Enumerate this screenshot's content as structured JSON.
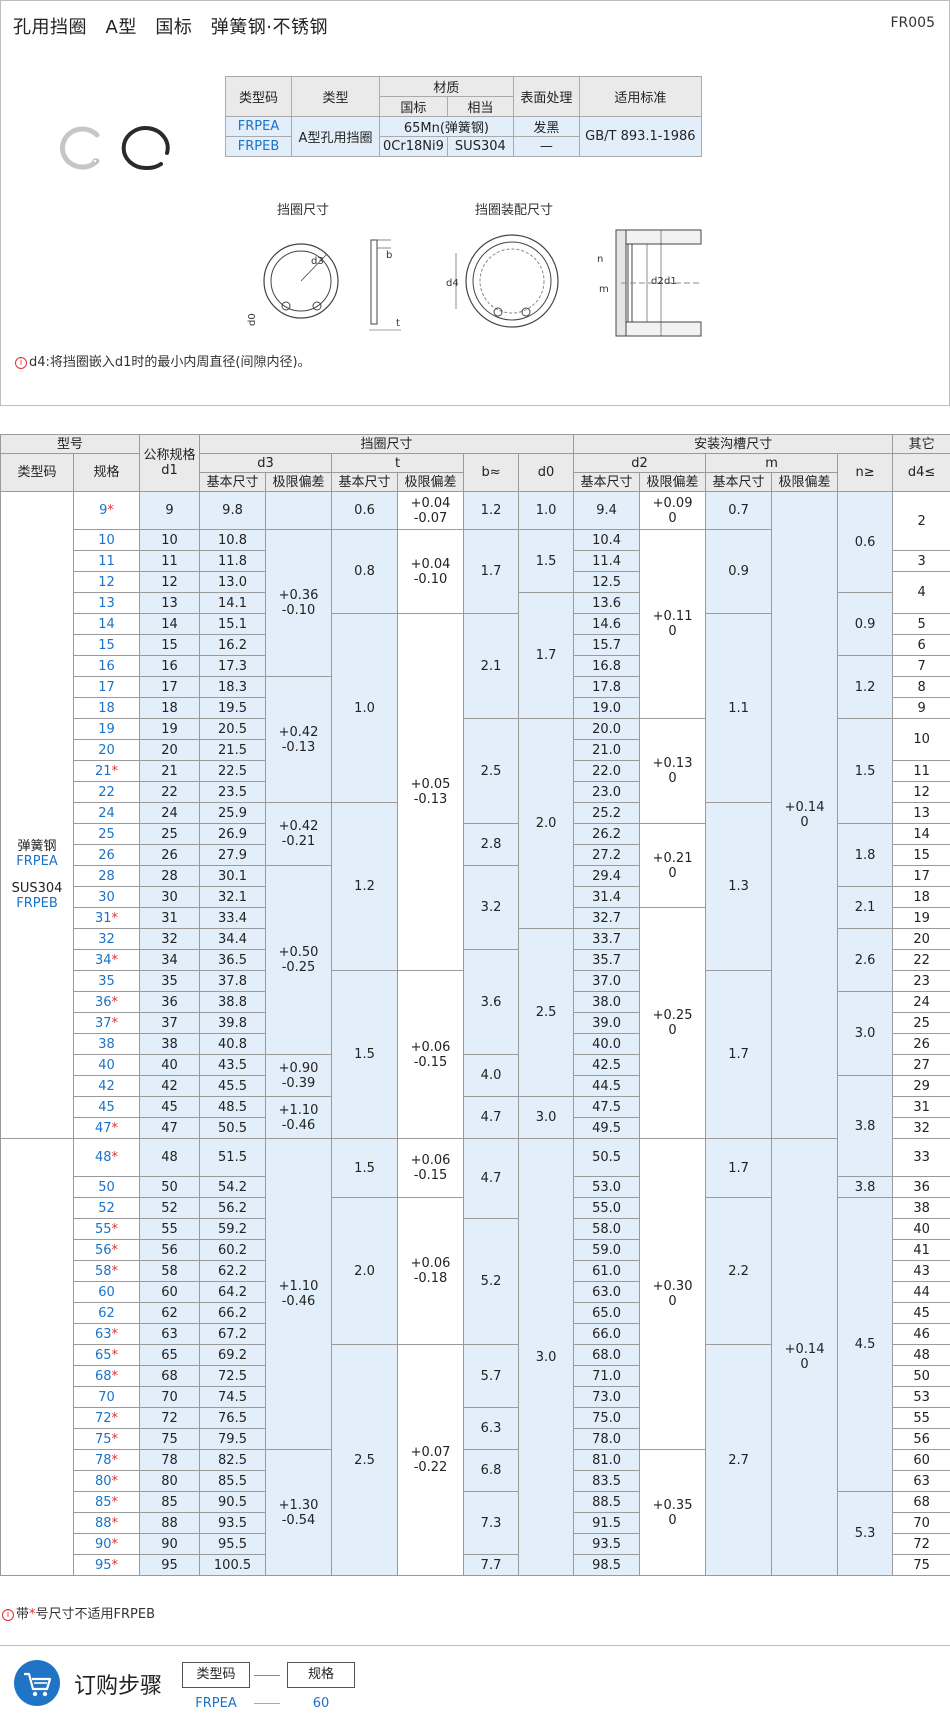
{
  "header": {
    "title": "孔用挡圈　A型　国标　弹簧钢·不锈钢",
    "code": "FR005"
  },
  "material_table": {
    "h_type_code": "类型码",
    "h_type": "类型",
    "h_material": "材质",
    "h_gb": "国标",
    "h_equiv": "相当",
    "h_surface": "表面处理",
    "h_standard": "适用标准",
    "type": "A型孔用挡圈",
    "standard": "GB/T 893.1-1986",
    "rows": [
      {
        "code": "FRPEA",
        "gb": "65Mn(弹簧钢)",
        "equiv": "",
        "surface": "发黑"
      },
      {
        "code": "FRPEB",
        "gb": "0Cr18Ni9",
        "equiv": "SUS304",
        "surface": "—"
      }
    ]
  },
  "diagram": {
    "cap_ring": "挡圈尺寸",
    "cap_assembly": "挡圈装配尺寸",
    "labels": {
      "d3": "d3",
      "d0": "d0",
      "b": "b",
      "t": "t",
      "d4": "d4",
      "n": "n",
      "m": "m",
      "d2": "d2",
      "d1": "d1"
    }
  },
  "note": {
    "icon": "i",
    "text": "d4:将挡圈嵌入d1时的最小内周直径(间隙内径)。"
  },
  "spec_table": {
    "h_model": "型号",
    "h_nominal": "公称规格d1",
    "h_ring": "挡圈尺寸",
    "h_groove": "安装沟槽尺寸",
    "h_other": "其它",
    "h_type_code": "类型码",
    "h_spec": "规格",
    "h_d3": "d3",
    "h_t": "t",
    "h_b": "b≈",
    "h_d0": "d0",
    "h_d2": "d2",
    "h_m": "m",
    "h_n": "n≥",
    "h_d4": "d4≤",
    "h_basic": "基本尺寸",
    "h_tol": "极限偏差",
    "type_label": {
      "mat1": "弹簧钢",
      "code1": "FRPEA",
      "mat2": "SUS304",
      "code2": "FRPEB"
    },
    "rows": [
      {
        "spec": "9",
        "star": true,
        "d1": "9",
        "d3": "9.8",
        "d2": "9.4"
      },
      {
        "spec": "10",
        "star": false,
        "d1": "10",
        "d3": "10.8",
        "d2": "10.4"
      },
      {
        "spec": "11",
        "star": false,
        "d1": "11",
        "d3": "11.8",
        "d2": "11.4"
      },
      {
        "spec": "12",
        "star": false,
        "d1": "12",
        "d3": "13.0",
        "d2": "12.5"
      },
      {
        "spec": "13",
        "star": false,
        "d1": "13",
        "d3": "14.1",
        "d2": "13.6"
      },
      {
        "spec": "14",
        "star": false,
        "d1": "14",
        "d3": "15.1",
        "d2": "14.6"
      },
      {
        "spec": "15",
        "star": false,
        "d1": "15",
        "d3": "16.2",
        "d2": "15.7"
      },
      {
        "spec": "16",
        "star": false,
        "d1": "16",
        "d3": "17.3",
        "d2": "16.8"
      },
      {
        "spec": "17",
        "star": false,
        "d1": "17",
        "d3": "18.3",
        "d2": "17.8"
      },
      {
        "spec": "18",
        "star": false,
        "d1": "18",
        "d3": "19.5",
        "d2": "19.0"
      },
      {
        "spec": "19",
        "star": false,
        "d1": "19",
        "d3": "20.5",
        "d2": "20.0"
      },
      {
        "spec": "20",
        "star": false,
        "d1": "20",
        "d3": "21.5",
        "d2": "21.0"
      },
      {
        "spec": "21",
        "star": true,
        "d1": "21",
        "d3": "22.5",
        "d2": "22.0"
      },
      {
        "spec": "22",
        "star": false,
        "d1": "22",
        "d3": "23.5",
        "d2": "23.0"
      },
      {
        "spec": "24",
        "star": false,
        "d1": "24",
        "d3": "25.9",
        "d2": "25.2"
      },
      {
        "spec": "25",
        "star": false,
        "d1": "25",
        "d3": "26.9",
        "d2": "26.2"
      },
      {
        "spec": "26",
        "star": false,
        "d1": "26",
        "d3": "27.9",
        "d2": "27.2"
      },
      {
        "spec": "28",
        "star": false,
        "d1": "28",
        "d3": "30.1",
        "d2": "29.4"
      },
      {
        "spec": "30",
        "star": false,
        "d1": "30",
        "d3": "32.1",
        "d2": "31.4"
      },
      {
        "spec": "31",
        "star": true,
        "d1": "31",
        "d3": "33.4",
        "d2": "32.7"
      },
      {
        "spec": "32",
        "star": false,
        "d1": "32",
        "d3": "34.4",
        "d2": "33.7"
      },
      {
        "spec": "34",
        "star": true,
        "d1": "34",
        "d3": "36.5",
        "d2": "35.7"
      },
      {
        "spec": "35",
        "star": false,
        "d1": "35",
        "d3": "37.8",
        "d2": "37.0"
      },
      {
        "spec": "36",
        "star": true,
        "d1": "36",
        "d3": "38.8",
        "d2": "38.0"
      },
      {
        "spec": "37",
        "star": true,
        "d1": "37",
        "d3": "39.8",
        "d2": "39.0"
      },
      {
        "spec": "38",
        "star": false,
        "d1": "38",
        "d3": "40.8",
        "d2": "40.0"
      },
      {
        "spec": "40",
        "star": false,
        "d1": "40",
        "d3": "43.5",
        "d2": "42.5"
      },
      {
        "spec": "42",
        "star": false,
        "d1": "42",
        "d3": "45.5",
        "d2": "44.5"
      },
      {
        "spec": "45",
        "star": false,
        "d1": "45",
        "d3": "48.5",
        "d2": "47.5"
      },
      {
        "spec": "47",
        "star": true,
        "d1": "47",
        "d3": "50.5",
        "d2": "49.5"
      },
      {
        "spec": "48",
        "star": true,
        "d1": "48",
        "d3": "51.5",
        "d2": "50.5"
      },
      {
        "spec": "50",
        "star": false,
        "d1": "50",
        "d3": "54.2",
        "d2": "53.0"
      },
      {
        "spec": "52",
        "star": false,
        "d1": "52",
        "d3": "56.2",
        "d2": "55.0"
      },
      {
        "spec": "55",
        "star": true,
        "d1": "55",
        "d3": "59.2",
        "d2": "58.0"
      },
      {
        "spec": "56",
        "star": true,
        "d1": "56",
        "d3": "60.2",
        "d2": "59.0"
      },
      {
        "spec": "58",
        "star": true,
        "d1": "58",
        "d3": "62.2",
        "d2": "61.0"
      },
      {
        "spec": "60",
        "star": false,
        "d1": "60",
        "d3": "64.2",
        "d2": "63.0"
      },
      {
        "spec": "62",
        "star": false,
        "d1": "62",
        "d3": "66.2",
        "d2": "65.0"
      },
      {
        "spec": "63",
        "star": true,
        "d1": "63",
        "d3": "67.2",
        "d2": "66.0"
      },
      {
        "spec": "65",
        "star": true,
        "d1": "65",
        "d3": "69.2",
        "d2": "68.0"
      },
      {
        "spec": "68",
        "star": true,
        "d1": "68",
        "d3": "72.5",
        "d2": "71.0"
      },
      {
        "spec": "70",
        "star": false,
        "d1": "70",
        "d3": "74.5",
        "d2": "73.0"
      },
      {
        "spec": "72",
        "star": true,
        "d1": "72",
        "d3": "76.5",
        "d2": "75.0"
      },
      {
        "spec": "75",
        "star": true,
        "d1": "75",
        "d3": "79.5",
        "d2": "78.0"
      },
      {
        "spec": "78",
        "star": true,
        "d1": "78",
        "d3": "82.5",
        "d2": "81.0"
      },
      {
        "spec": "80",
        "star": true,
        "d1": "80",
        "d3": "85.5",
        "d2": "83.5"
      },
      {
        "spec": "85",
        "star": true,
        "d1": "85",
        "d3": "90.5",
        "d2": "88.5"
      },
      {
        "spec": "88",
        "star": true,
        "d1": "88",
        "d3": "93.5",
        "d2": "91.5"
      },
      {
        "spec": "90",
        "star": true,
        "d1": "90",
        "d3": "95.5",
        "d2": "93.5"
      },
      {
        "spec": "95",
        "star": true,
        "d1": "95",
        "d3": "100.5",
        "d2": "98.5"
      }
    ],
    "spans": {
      "d3tol": [
        [
          0,
          1,
          "",
          "b"
        ],
        [
          1,
          7,
          "+0.36\n-0.10",
          "b"
        ],
        [
          8,
          6,
          "+0.42\n-0.13",
          "b"
        ],
        [
          14,
          3,
          "+0.42\n-0.21",
          "b"
        ],
        [
          17,
          9,
          "+0.50\n-0.25",
          "b"
        ],
        [
          26,
          2,
          "+0.90\n-0.39",
          "b"
        ],
        [
          28,
          2,
          "+1.10\n-0.46",
          "b"
        ],
        [
          30,
          14,
          "+1.10\n-0.46",
          "b"
        ],
        [
          44,
          6,
          "+1.30\n-0.54",
          "b"
        ]
      ],
      "t": [
        [
          0,
          1,
          "0.6",
          "b"
        ],
        [
          1,
          4,
          "0.8",
          "b"
        ],
        [
          5,
          9,
          "1.0",
          "b"
        ],
        [
          14,
          8,
          "1.2",
          "b"
        ],
        [
          22,
          8,
          "1.5",
          "b"
        ],
        [
          30,
          2,
          "1.5",
          "b"
        ],
        [
          32,
          7,
          "2.0",
          "b"
        ],
        [
          39,
          11,
          "2.5",
          "b"
        ]
      ],
      "ttol": [
        [
          0,
          1,
          "+0.04\n-0.07",
          "w"
        ],
        [
          1,
          4,
          "+0.04\n-0.10",
          "w"
        ],
        [
          5,
          17,
          "+0.05\n-0.13",
          "w"
        ],
        [
          22,
          8,
          "+0.06\n-0.15",
          "w"
        ],
        [
          30,
          2,
          "+0.06\n-0.15",
          "w"
        ],
        [
          32,
          7,
          "+0.06\n-0.18",
          "w"
        ],
        [
          39,
          11,
          "+0.07\n-0.22",
          "w"
        ]
      ],
      "b": [
        [
          0,
          1,
          "1.2",
          "b"
        ],
        [
          1,
          4,
          "1.7",
          "b"
        ],
        [
          5,
          5,
          "2.1",
          "b"
        ],
        [
          10,
          5,
          "2.5",
          "b"
        ],
        [
          15,
          2,
          "2.8",
          "b"
        ],
        [
          17,
          4,
          "3.2",
          "b"
        ],
        [
          21,
          5,
          "3.6",
          "b"
        ],
        [
          26,
          2,
          "4.0",
          "b"
        ],
        [
          28,
          2,
          "4.7",
          "b"
        ],
        [
          30,
          3,
          "4.7",
          "b"
        ],
        [
          33,
          6,
          "5.2",
          "b"
        ],
        [
          39,
          3,
          "5.7",
          "b"
        ],
        [
          42,
          2,
          "6.3",
          "b"
        ],
        [
          44,
          2,
          "6.8",
          "b"
        ],
        [
          46,
          3,
          "7.3",
          "b"
        ],
        [
          49,
          1,
          "7.7",
          "b"
        ]
      ],
      "d0": [
        [
          0,
          1,
          "1.0",
          "b"
        ],
        [
          1,
          3,
          "1.5",
          "b"
        ],
        [
          4,
          6,
          "1.7",
          "b"
        ],
        [
          10,
          10,
          "2.0",
          "b"
        ],
        [
          20,
          8,
          "2.5",
          "b"
        ],
        [
          28,
          2,
          "3.0",
          "b"
        ],
        [
          30,
          20,
          "3.0",
          "b"
        ]
      ],
      "d2tol": [
        [
          0,
          1,
          "+0.09\n0",
          "w"
        ],
        [
          1,
          9,
          "+0.11\n0",
          "w"
        ],
        [
          10,
          5,
          "+0.13\n0",
          "w"
        ],
        [
          15,
          4,
          "+0.21\n0",
          "w"
        ],
        [
          19,
          11,
          "+0.25\n0",
          "w"
        ],
        [
          30,
          14,
          "+0.30\n0",
          "w"
        ],
        [
          44,
          6,
          "+0.35\n0",
          "w"
        ]
      ],
      "m": [
        [
          0,
          1,
          "0.7",
          "b"
        ],
        [
          1,
          4,
          "0.9",
          "b"
        ],
        [
          5,
          9,
          "1.1",
          "b"
        ],
        [
          14,
          8,
          "1.3",
          "b"
        ],
        [
          22,
          8,
          "1.7",
          "b"
        ],
        [
          30,
          2,
          "1.7",
          "b"
        ],
        [
          32,
          7,
          "2.2",
          "b"
        ],
        [
          39,
          11,
          "2.7",
          "b"
        ]
      ],
      "mtol": [
        [
          0,
          30,
          "+0.14\n0",
          "b"
        ],
        [
          30,
          20,
          "+0.14\n0",
          "b"
        ]
      ],
      "n": [
        [
          0,
          4,
          "0.6",
          "b"
        ],
        [
          4,
          3,
          "0.9",
          "b"
        ],
        [
          7,
          3,
          "1.2",
          "b"
        ],
        [
          10,
          5,
          "1.5",
          "b"
        ],
        [
          15,
          3,
          "1.8",
          "b"
        ],
        [
          18,
          2,
          "2.1",
          "b"
        ],
        [
          20,
          3,
          "2.6",
          "b"
        ],
        [
          23,
          4,
          "3.0",
          "b"
        ],
        [
          27,
          4,
          "3.8",
          "b"
        ],
        [
          31,
          1,
          "3.8",
          "b"
        ],
        [
          32,
          14,
          "4.5",
          "b"
        ],
        [
          46,
          4,
          "5.3",
          "b"
        ]
      ],
      "d4": [
        [
          0,
          2,
          "2",
          "w"
        ],
        [
          2,
          1,
          "3",
          "w"
        ],
        [
          3,
          2,
          "4",
          "w"
        ],
        [
          5,
          1,
          "5",
          "w"
        ],
        [
          6,
          1,
          "6",
          "w"
        ],
        [
          7,
          1,
          "7",
          "w"
        ],
        [
          8,
          1,
          "8",
          "w"
        ],
        [
          9,
          1,
          "9",
          "w"
        ],
        [
          10,
          2,
          "10",
          "w"
        ],
        [
          12,
          1,
          "11",
          "w"
        ],
        [
          13,
          1,
          "12",
          "w"
        ],
        [
          14,
          1,
          "13",
          "w"
        ],
        [
          15,
          1,
          "14",
          "w"
        ],
        [
          16,
          1,
          "15",
          "w"
        ],
        [
          17,
          1,
          "17",
          "w"
        ],
        [
          18,
          1,
          "18",
          "w"
        ],
        [
          19,
          1,
          "19",
          "w"
        ],
        [
          20,
          1,
          "20",
          "w"
        ],
        [
          21,
          1,
          "22",
          "w"
        ],
        [
          22,
          1,
          "23",
          "w"
        ],
        [
          23,
          1,
          "24",
          "w"
        ],
        [
          24,
          1,
          "25",
          "w"
        ],
        [
          25,
          1,
          "26",
          "w"
        ],
        [
          26,
          1,
          "27",
          "w"
        ],
        [
          27,
          1,
          "29",
          "w"
        ],
        [
          28,
          1,
          "31",
          "w"
        ],
        [
          29,
          1,
          "32",
          "w"
        ],
        [
          30,
          1,
          "33",
          "w"
        ],
        [
          31,
          1,
          "36",
          "w"
        ],
        [
          32,
          1,
          "38",
          "w"
        ],
        [
          33,
          1,
          "40",
          "w"
        ],
        [
          34,
          1,
          "41",
          "w"
        ],
        [
          35,
          1,
          "43",
          "w"
        ],
        [
          36,
          1,
          "44",
          "w"
        ],
        [
          37,
          1,
          "45",
          "w"
        ],
        [
          38,
          1,
          "46",
          "w"
        ],
        [
          39,
          1,
          "48",
          "w"
        ],
        [
          40,
          1,
          "50",
          "w"
        ],
        [
          41,
          1,
          "53",
          "w"
        ],
        [
          42,
          1,
          "55",
          "w"
        ],
        [
          43,
          1,
          "56",
          "w"
        ],
        [
          44,
          1,
          "60",
          "w"
        ],
        [
          45,
          1,
          "63",
          "w"
        ],
        [
          46,
          1,
          "68",
          "w"
        ],
        [
          47,
          1,
          "70",
          "w"
        ],
        [
          48,
          1,
          "72",
          "w"
        ],
        [
          49,
          1,
          "75",
          "w"
        ]
      ]
    },
    "row_kind": "tall rows: 0 and 30"
  },
  "footnote": {
    "text": "带*号尺寸不适用FRPEB",
    "star": "*"
  },
  "order": {
    "title": "订购步骤",
    "col1": "类型码",
    "col2": "规格",
    "val1": "FRPEA",
    "val2": "60"
  },
  "colors": {
    "accent_blue": "#1a73c8",
    "cell_blue": "#e2effa",
    "header_gray": "#eaeaea",
    "star_red": "#e23030"
  }
}
